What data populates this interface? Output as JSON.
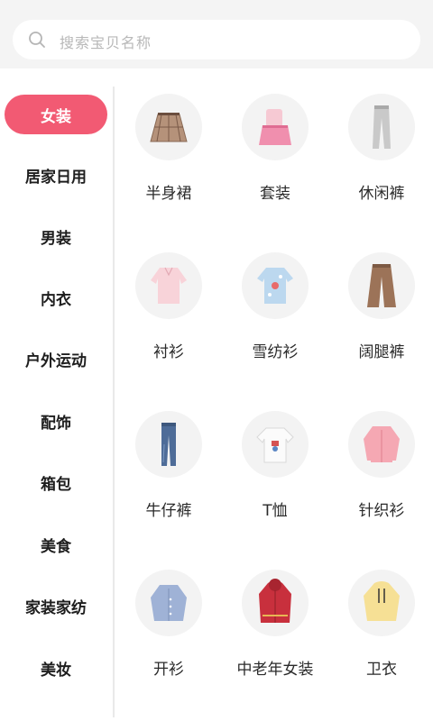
{
  "search": {
    "placeholder": "搜索宝贝名称",
    "icon": "search-icon"
  },
  "sidebar": {
    "active_index": 0,
    "accent_color": "#f25a73",
    "items": [
      {
        "label": "女装"
      },
      {
        "label": "居家日用"
      },
      {
        "label": "男装"
      },
      {
        "label": "内衣"
      },
      {
        "label": "户外运动"
      },
      {
        "label": "配饰"
      },
      {
        "label": "箱包"
      },
      {
        "label": "美食"
      },
      {
        "label": "家装家纺"
      },
      {
        "label": "美妆"
      }
    ]
  },
  "categories": [
    {
      "label": "半身裙",
      "icon": "plaid-skirt-icon"
    },
    {
      "label": "套装",
      "icon": "two-piece-outfit-icon"
    },
    {
      "label": "休闲裤",
      "icon": "grey-trousers-icon"
    },
    {
      "label": "衬衫",
      "icon": "pink-blouse-icon"
    },
    {
      "label": "雪纺衫",
      "icon": "chiffon-shirt-icon"
    },
    {
      "label": "阔腿裤",
      "icon": "wide-leg-pants-icon"
    },
    {
      "label": "牛仔裤",
      "icon": "jeans-icon"
    },
    {
      "label": "T恤",
      "icon": "tshirt-icon"
    },
    {
      "label": "针织衫",
      "icon": "knit-cardigan-icon"
    },
    {
      "label": "开衫",
      "icon": "blue-cardigan-icon"
    },
    {
      "label": "中老年女装",
      "icon": "red-coat-icon"
    },
    {
      "label": "卫衣",
      "icon": "yellow-hoodie-icon"
    }
  ]
}
